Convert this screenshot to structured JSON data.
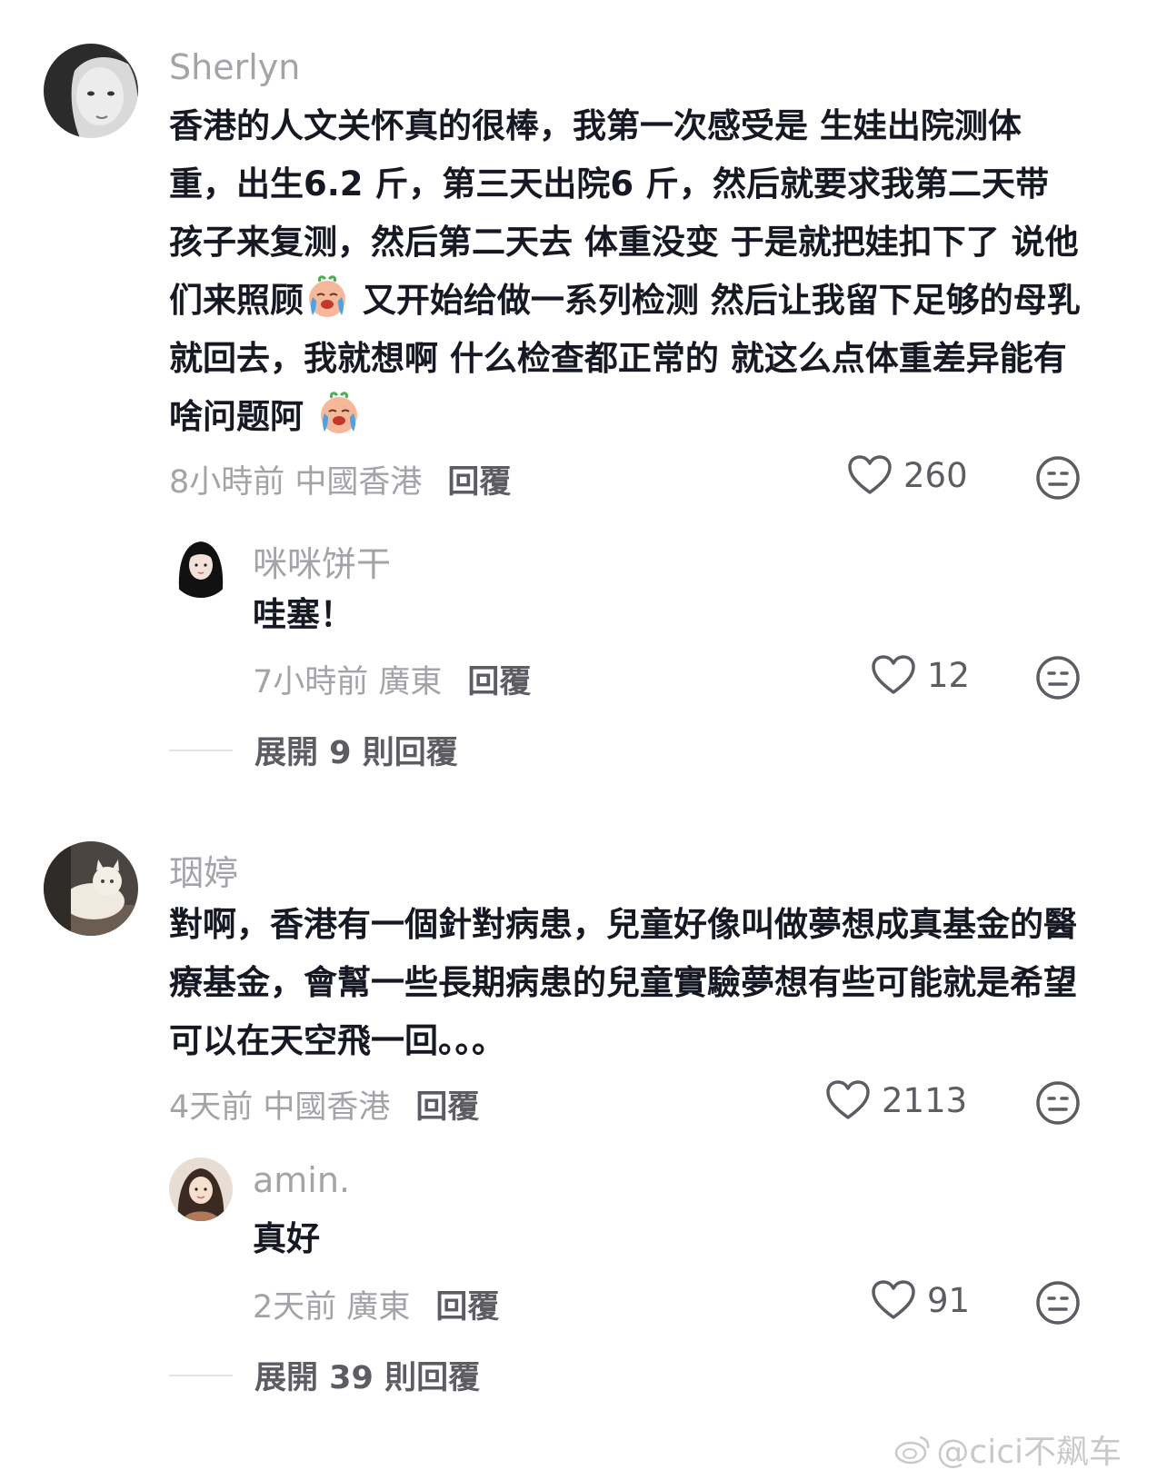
{
  "comments": [
    {
      "username": "Sherlyn",
      "text_parts": [
        "香港的人文关怀真的很棒，我第一次感受是 生娃出院测体重，出生6.2 斤，第三天出院6 斤，然后就要求我第二天带孩子来复测，然后第二天去 体重没变 于是就把娃扣下了 说他们来照顾",
        " 又开始给做一系列检测 然后让我留下足够的母乳就回去，我就想啊 什么检查都正常的 就这么点体重差异能有啥问题阿 "
      ],
      "time_location": "8小時前 中國香港",
      "reply": "回覆",
      "likes": "260",
      "replies": [
        {
          "username": "咪咪饼干",
          "text": "哇塞！",
          "time_location": "7小時前 廣東",
          "reply": "回覆",
          "likes": "12"
        }
      ],
      "expand": "展開 9 則回覆"
    },
    {
      "username": "珚婷",
      "text": "對啊，香港有一個針對病患，兒童好像叫做夢想成真基金的醫療基金，會幫一些長期病患的兒童實驗夢想有些可能就是希望可以在天空飛一回。。。",
      "time_location": "4天前 中國香港",
      "reply": "回覆",
      "likes": "2113",
      "replies": [
        {
          "username": "amin.",
          "text": "真好",
          "time_location": "2天前 廣東",
          "reply": "回覆",
          "likes": "91"
        }
      ],
      "expand": "展開 39 則回覆"
    }
  ],
  "watermark": "@cici不飙车",
  "icons": {
    "like": "heart-outline-icon",
    "dislike": "neutral-face-icon",
    "emoji": "crying-face-emoji"
  },
  "colors": {
    "text": "#161823",
    "muted": "#a3a4a8",
    "secondary": "#5c5d63"
  }
}
